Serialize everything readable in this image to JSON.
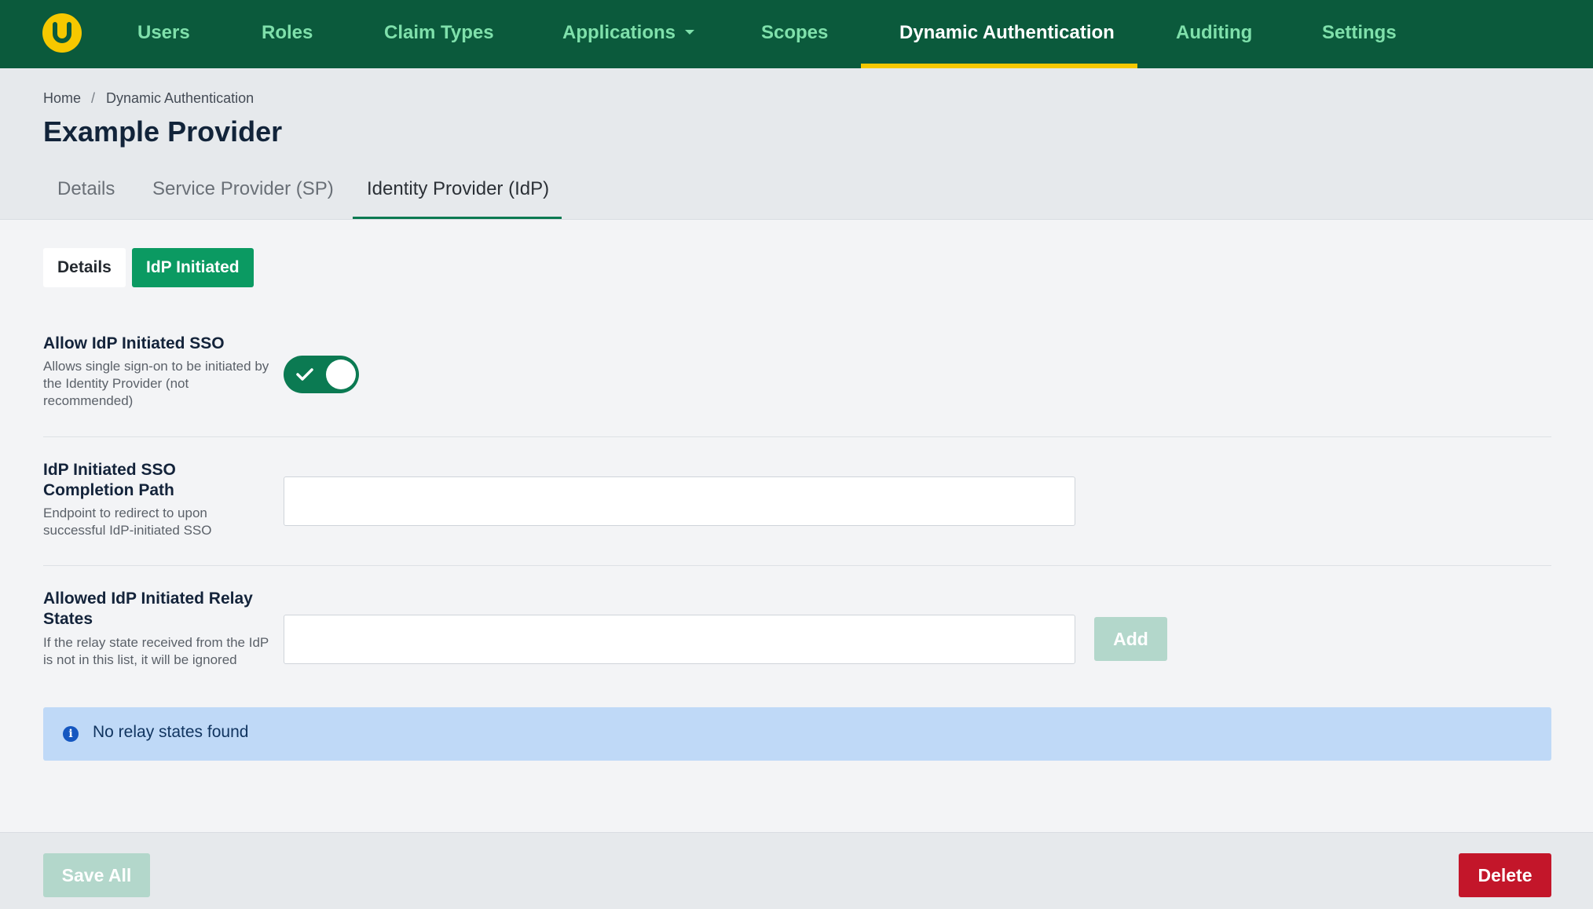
{
  "nav": {
    "logo_icon": "u-logo-icon",
    "items": [
      {
        "label": "Users"
      },
      {
        "label": "Roles"
      },
      {
        "label": "Claim Types"
      },
      {
        "label": "Applications"
      },
      {
        "label": "Scopes"
      },
      {
        "label": "Dynamic Authentication"
      },
      {
        "label": "Auditing"
      },
      {
        "label": "Settings"
      }
    ],
    "active": "Dynamic Authentication"
  },
  "breadcrumb": {
    "items": [
      "Home",
      "Dynamic Authentication"
    ],
    "separator": "/"
  },
  "page": {
    "title": "Example Provider"
  },
  "tabs": [
    {
      "label": "Details"
    },
    {
      "label": "Service Provider (SP)"
    },
    {
      "label": "Identity Provider (IdP)"
    }
  ],
  "subtabs": [
    {
      "label": "Details"
    },
    {
      "label": "IdP Initiated"
    }
  ],
  "fields": {
    "allow_sso": {
      "label": "Allow IdP Initiated SSO",
      "description": "Allows single sign-on to be initiated by the Identity Provider (not recommended)",
      "enabled": true
    },
    "completion_path": {
      "label": "IdP Initiated SSO Completion Path",
      "description": "Endpoint to redirect to upon successful IdP-initiated SSO",
      "value": ""
    },
    "relay_states": {
      "label": "Allowed IdP Initiated Relay States",
      "description": "If the relay state received from the IdP is not in this list, it will be ignored",
      "value": "",
      "add_label": "Add",
      "empty_message": "No relay states found"
    }
  },
  "footer": {
    "save_label": "Save All",
    "delete_label": "Delete"
  },
  "colors": {
    "nav_bg": "#0b5a3c",
    "accent": "#f6c800",
    "primary": "#0b9a62",
    "danger": "#c3162a",
    "info_bg": "#bfd9f7"
  }
}
